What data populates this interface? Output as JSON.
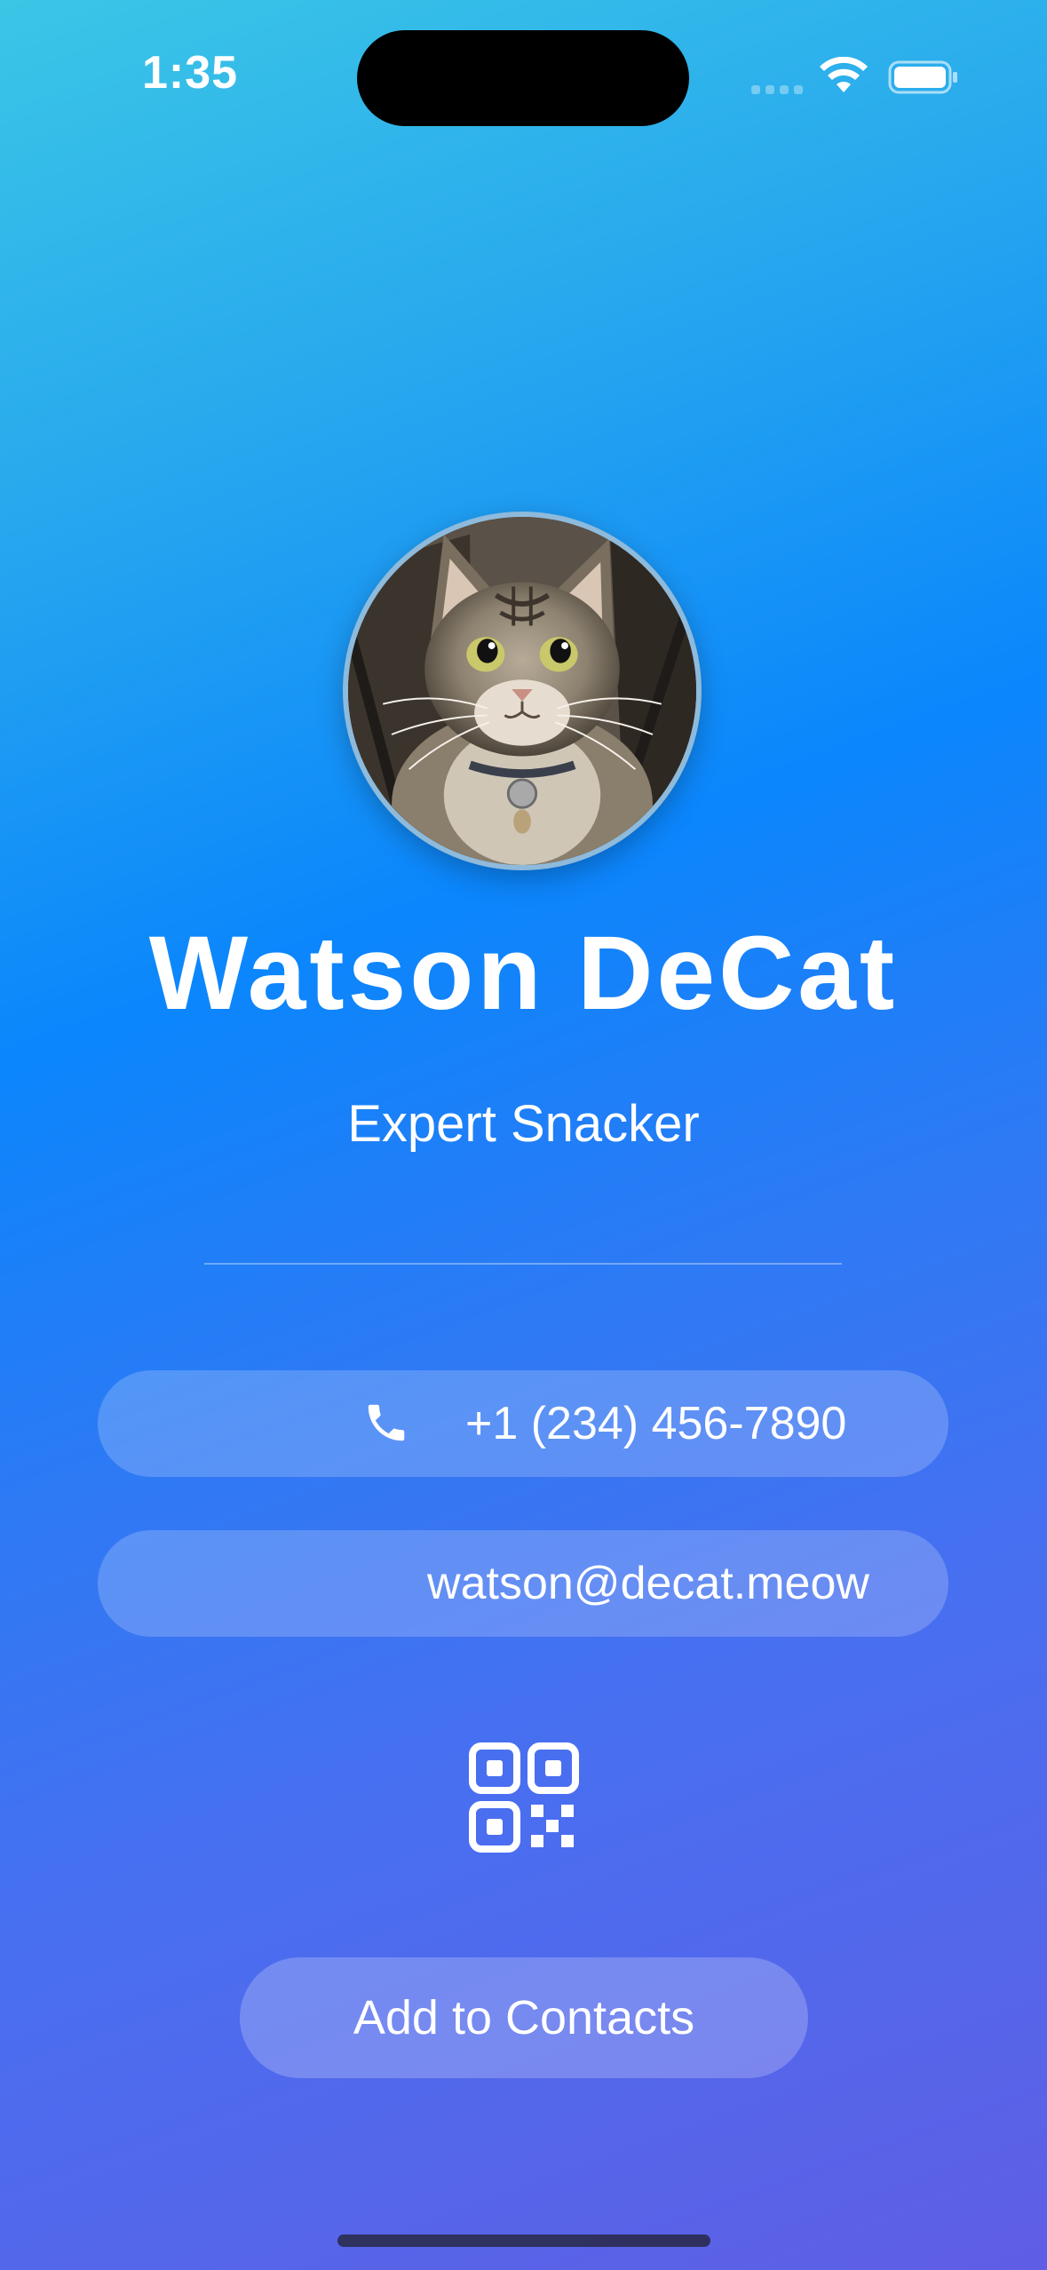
{
  "status_bar": {
    "time": "1:35"
  },
  "profile": {
    "name": "Watson DeCat",
    "title": "Expert Snacker"
  },
  "contact": {
    "phone": "+1 (234) 456-7890",
    "email": "watson@decat.meow"
  },
  "actions": {
    "add_label": "Add to Contacts"
  },
  "icons": {
    "phone": "phone-icon",
    "qr": "qr-code-icon",
    "wifi": "wifi-icon",
    "battery": "battery-icon"
  },
  "colors": {
    "gradient_top": "#3bc6e6",
    "gradient_mid": "#0b86fc",
    "gradient_bottom": "#5f5ee4",
    "text": "#ffffff"
  }
}
